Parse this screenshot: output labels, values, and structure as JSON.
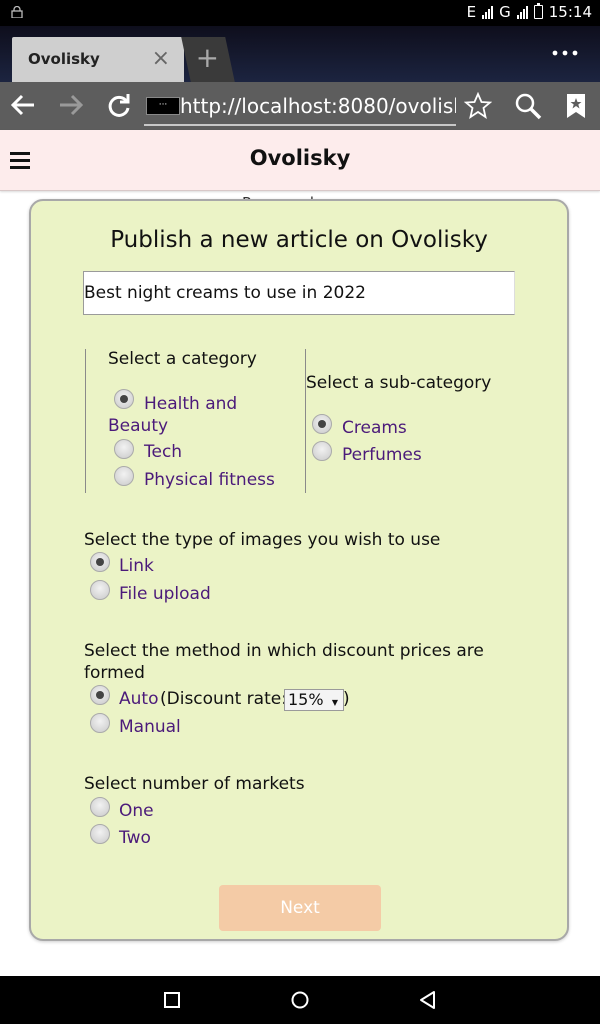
{
  "status_bar": {
    "network": "E",
    "network2": "G",
    "time": "15:14"
  },
  "browser": {
    "tab_title": "Ovolisky",
    "tab_close": "×",
    "new_tab": "+",
    "menu": "⋮",
    "url": "http://localhost:8080/ovolisk",
    "url_badge": "···"
  },
  "site": {
    "title": "Ovolisky",
    "hidden_label": "Pages pub..."
  },
  "form": {
    "heading": "Publish a new article on Ovolisky",
    "article_title_value": "Best night creams to use in 2022",
    "category": {
      "legend": "Select a category",
      "options": [
        "Health and Beauty",
        "Tech",
        "Physical fitness"
      ],
      "selected": "Health and Beauty"
    },
    "subcategory": {
      "legend": "Select a sub-category",
      "options": [
        "Creams",
        "Perfumes"
      ],
      "selected": "Creams"
    },
    "image_type": {
      "question": "Select the type of images you wish to use",
      "options": [
        "Link",
        "File upload"
      ],
      "selected": "Link"
    },
    "discount": {
      "question": "Select the method in which discount prices are formed",
      "auto_label": "Auto",
      "rate_prefix": "(Discount rate:",
      "rate_value": "15%",
      "rate_suffix": ")",
      "manual_label": "Manual",
      "selected": "Auto"
    },
    "markets": {
      "question": "Select number of markets",
      "options": [
        "One",
        "Two"
      ]
    },
    "next_label": "Next"
  }
}
